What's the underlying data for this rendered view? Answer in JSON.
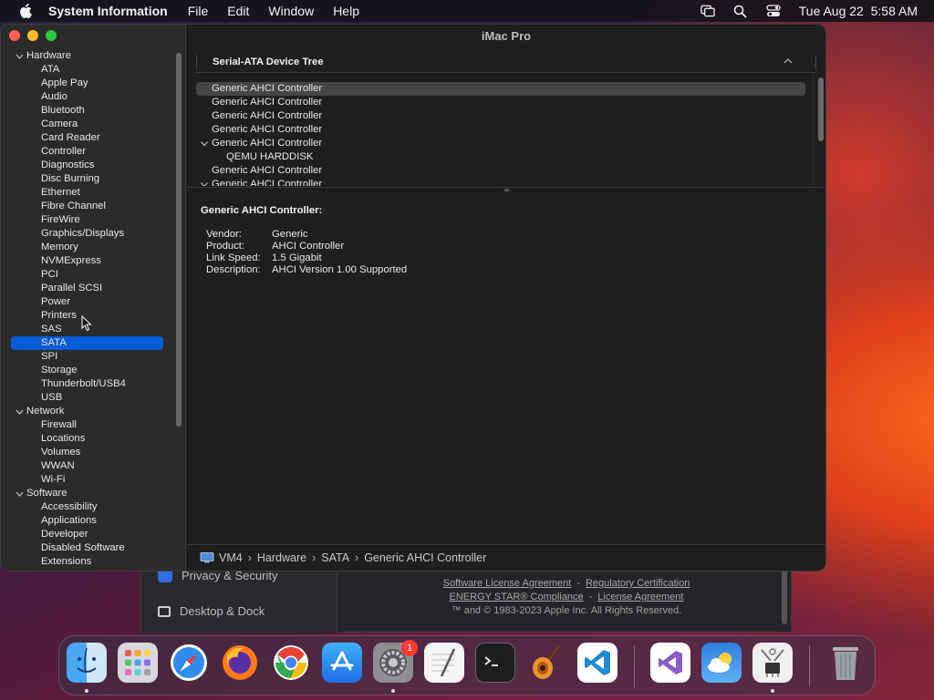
{
  "menubar": {
    "app_name": "System Information",
    "menus": [
      "File",
      "Edit",
      "Window",
      "Help"
    ],
    "datetime": "Tue Aug 22  5:58 AM",
    "icons": [
      "apple-icon",
      "screen-mirroring-icon",
      "search-icon",
      "control-center-icon"
    ]
  },
  "window": {
    "title": "iMac Pro"
  },
  "sidebar": {
    "groups": [
      {
        "label": "Hardware",
        "expanded": true,
        "items": [
          "ATA",
          "Apple Pay",
          "Audio",
          "Bluetooth",
          "Camera",
          "Card Reader",
          "Controller",
          "Diagnostics",
          "Disc Burning",
          "Ethernet",
          "Fibre Channel",
          "FireWire",
          "Graphics/Displays",
          "Memory",
          "NVMExpress",
          "PCI",
          "Parallel SCSI",
          "Power",
          "Printers",
          "SAS",
          "SATA",
          "SPI",
          "Storage",
          "Thunderbolt/USB4",
          "USB"
        ]
      },
      {
        "label": "Network",
        "expanded": true,
        "items": [
          "Firewall",
          "Locations",
          "Volumes",
          "WWAN",
          "Wi-Fi"
        ]
      },
      {
        "label": "Software",
        "expanded": true,
        "items": [
          "Accessibility",
          "Applications",
          "Developer",
          "Disabled Software",
          "Extensions"
        ]
      }
    ],
    "selected": "SATA"
  },
  "device_tree": {
    "column_header": "Serial-ATA Device Tree",
    "rows": [
      {
        "label": "Generic AHCI Controller",
        "level": 0,
        "selected": true,
        "expanded": false
      },
      {
        "label": "Generic AHCI Controller",
        "level": 0,
        "selected": false,
        "expanded": false
      },
      {
        "label": "Generic AHCI Controller",
        "level": 0,
        "selected": false,
        "expanded": false
      },
      {
        "label": "Generic AHCI Controller",
        "level": 0,
        "selected": false,
        "expanded": false
      },
      {
        "label": "Generic AHCI Controller",
        "level": 0,
        "selected": false,
        "expanded": true
      },
      {
        "label": "QEMU HARDDISK",
        "level": 1,
        "selected": false,
        "expanded": false
      },
      {
        "label": "Generic AHCI Controller",
        "level": 0,
        "selected": false,
        "expanded": false
      },
      {
        "label": "Generic AHCI Controller",
        "level": 0,
        "selected": false,
        "expanded": true
      }
    ]
  },
  "detail": {
    "title": "Generic AHCI Controller:",
    "properties": [
      {
        "key": "Vendor:",
        "value": "Generic"
      },
      {
        "key": "Product:",
        "value": "AHCI Controller"
      },
      {
        "key": "Link Speed:",
        "value": "1.5 Gigabit"
      },
      {
        "key": "Description:",
        "value": "AHCI Version 1.00 Supported"
      }
    ]
  },
  "pathbar": {
    "components": [
      "VM4",
      "Hardware",
      "SATA",
      "Generic AHCI Controller"
    ]
  },
  "background_window": {
    "sidebar_items": [
      "Privacy & Security",
      "Desktop & Dock"
    ],
    "footer": {
      "link1": "Software License Agreement",
      "link2": "Regulatory Certification",
      "link3": "ENERGY STAR® Compliance",
      "link4": "License Agreement",
      "separator": "-",
      "copyright": "™ and © 1983-2023 Apple Inc. All Rights Reserved."
    }
  },
  "dock": {
    "apps": [
      {
        "name": "finder-icon",
        "running": true
      },
      {
        "name": "launchpad-icon",
        "running": false
      },
      {
        "name": "safari-icon",
        "running": false
      },
      {
        "name": "firefox-icon",
        "running": false
      },
      {
        "name": "chrome-icon",
        "running": false
      },
      {
        "name": "app-store-icon",
        "running": false
      },
      {
        "name": "system-settings-icon",
        "running": true,
        "badge": "1"
      },
      {
        "name": "textedit-icon",
        "running": false
      },
      {
        "name": "terminal-icon",
        "running": false
      },
      {
        "name": "garageband-icon",
        "running": false
      },
      {
        "name": "vscode-icon",
        "running": false
      },
      {
        "name": "visual-studio-icon",
        "running": false
      },
      {
        "name": "weather-icon",
        "running": false
      },
      {
        "name": "system-information-icon",
        "running": true
      },
      {
        "name": "trash-icon",
        "running": false
      }
    ]
  },
  "colors": {
    "selection_blue": "#0a5bd6",
    "close": "#ff5f57",
    "minimize": "#febc2e",
    "zoom": "#28c840"
  }
}
